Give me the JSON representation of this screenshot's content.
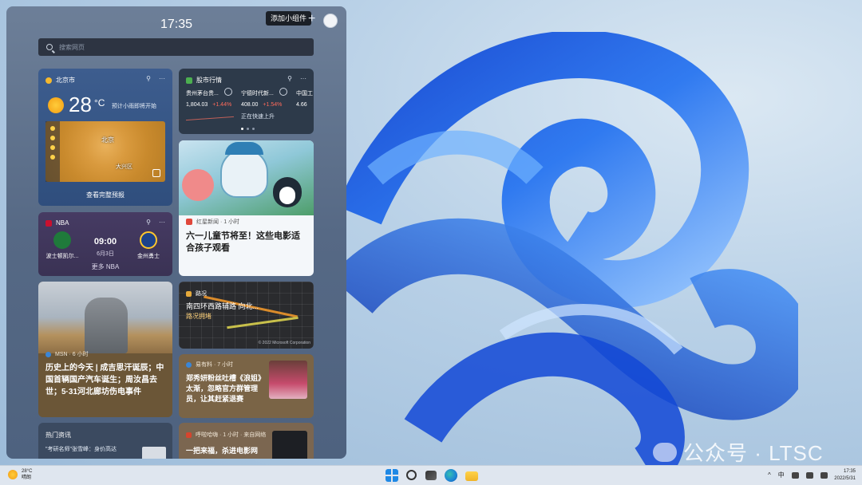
{
  "panel": {
    "clock": "17:35",
    "add_widget_label": "添加小组件",
    "plus_label": "+",
    "search_placeholder": "搜索网页"
  },
  "weather": {
    "location": "北京市",
    "temperature": "28",
    "unit": "°C",
    "forecast": "预计小雨即将开始",
    "map_city": "北京",
    "map_district": "大兴区",
    "full_forecast": "查看完整预报",
    "more": "···",
    "pin": "📌"
  },
  "stocks": {
    "title": "股市行情",
    "items": [
      {
        "name": "贵州茅台贵...",
        "price": "1,804.03",
        "change": "+1.44%"
      },
      {
        "name": "宁德时代新...",
        "price": "408.00",
        "change": "+1.54%",
        "note": "正在快速上升"
      },
      {
        "name": "中国工",
        "price": "4.66",
        "change": ""
      }
    ]
  },
  "kids_news": {
    "source": "红星新闻 · 1 小时",
    "title": "六一儿童节将至！这些电影适合孩子观看"
  },
  "nba": {
    "title": "NBA",
    "home": "波士顿凯尔...",
    "time": "09:00",
    "date": "6月3日",
    "away": "金州勇士",
    "more": "更多 NBA"
  },
  "history": {
    "source": "MSN · 6 小时",
    "title": "历史上的今天 | 成吉思汗诞辰；中国首辆国产汽车诞生；周汝昌去世；5·31河北廊坊伤电事件"
  },
  "traffic": {
    "title": "路况",
    "road": "南四环西路辅路 向北...",
    "status": "路况拥堵",
    "copyright": "© 2022 Microsoft Corporation"
  },
  "drama": {
    "source": "易有料 · 7 小时",
    "title": "郑秀妍粉丝吐槽《浪姐》太渐，忽略官方群管理员，让其赶紧退赛"
  },
  "hot": {
    "title": "热门资讯",
    "item": "\"考研名师\"张雪峰：身价高达"
  },
  "feed": {
    "source": "呼啦哈嗨 · 1 小时 · 来自网络",
    "title": "一把来福，杀进电影网"
  },
  "taskbar": {
    "weather_temp": "28°C",
    "weather_desc": "晴朗",
    "ime": "中",
    "time": "17:35",
    "date": "2022/5/31"
  },
  "watermark": "公众号 · LTSC",
  "colors": {
    "accent": "#1e88e5",
    "stock_up": "#ff6b5b"
  }
}
